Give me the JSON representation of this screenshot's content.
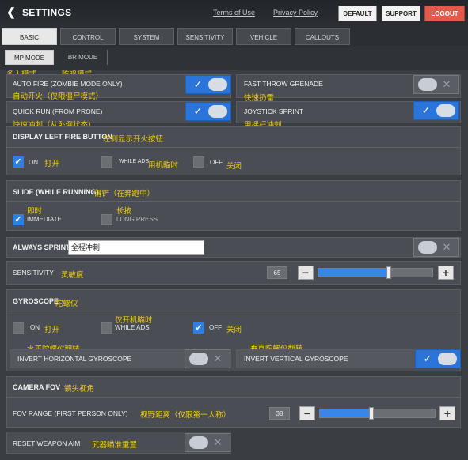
{
  "header": {
    "title": "SETTINGS",
    "links": [
      "Terms of Use",
      "Privacy Policy"
    ],
    "buttons": {
      "default": "DEFAULT",
      "support": "SUPPORT",
      "logout": "LOGOUT"
    }
  },
  "tabs": [
    "BASIC",
    "CONTROL",
    "SYSTEM",
    "SENSITIVITY",
    "VEHICLE",
    "CALLOUTS"
  ],
  "active_tab": "BASIC",
  "subtabs": [
    "MP MODE",
    "BR MODE"
  ],
  "active_subtab": "MP MODE",
  "annotations": {
    "mp_mode": "多人模式",
    "br_mode": "吃鸡模式"
  },
  "settings": {
    "auto_fire": {
      "label": "AUTO FIRE (ZOMBIE MODE ONLY)",
      "cn": "自动开火（仅限僵尸模式）",
      "on": true
    },
    "fast_throw": {
      "label": "FAST THROW GRENADE",
      "cn": "快速扔雷",
      "on": false
    },
    "quick_run": {
      "label": "QUICK RUN (FROM PRONE)",
      "cn": "快速冲刺（从卧倒状态）",
      "on": true
    },
    "joystick_sprint": {
      "label": "JOYSTICK SPRINT",
      "cn": "用摇杆冲刺",
      "on": true
    },
    "left_fire": {
      "label": "DISPLAY LEFT FIRE BUTTON",
      "cn": "左侧显示开火按钮",
      "options": [
        {
          "label": "ON",
          "cn": "打开",
          "checked": true
        },
        {
          "label": "WHILE ADS",
          "cn": "用机瞄时",
          "checked": false
        },
        {
          "label": "OFF",
          "cn": "关闭",
          "checked": false
        }
      ]
    },
    "slide": {
      "label": "SLIDE (WHILE RUNNING)",
      "cn": "滑铲（在奔跑中）",
      "options": [
        {
          "label": "IMMEDIATE",
          "cn": "即时",
          "checked": true
        },
        {
          "label": "LONG PRESS",
          "cn": "长按",
          "checked": false
        }
      ]
    },
    "always_sprint": {
      "label": "ALWAYS SPRINT",
      "cn": "全程冲刺",
      "on": false
    },
    "sensitivity": {
      "label": "SENSITIVITY",
      "cn": "灵敏度",
      "value": "65",
      "fraction": 0.62
    },
    "gyroscope": {
      "label": "GYROSCOPE",
      "cn": "陀螺仪",
      "options": [
        {
          "label": "ON",
          "cn": "打开",
          "checked": false
        },
        {
          "label": "WHILE ADS",
          "cn": "仅开机瞄时",
          "checked": false
        },
        {
          "label": "OFF",
          "cn": "关闭",
          "checked": true
        }
      ]
    },
    "invert_h": {
      "label": "INVERT HORIZONTAL GYROSCOPE",
      "cn": "水平陀螺仪翻转",
      "on": false
    },
    "invert_v": {
      "label": "INVERT VERTICAL GYROSCOPE",
      "cn": "垂直陀螺仪翻转",
      "on": true
    },
    "camera_fov": {
      "label": "CAMERA FOV",
      "cn": "镜头视角"
    },
    "fov_range": {
      "label": "FOV RANGE (FIRST PERSON ONLY)",
      "cn": "视野距离（仅限第一人称）",
      "value": "38",
      "fraction": 0.45
    },
    "reset_aim": {
      "label": "RESET WEAPON AIM",
      "cn": "武器瞄准重置",
      "on": false
    }
  },
  "colors": {
    "accent": "#2b74d9",
    "annotation": "#f0d000",
    "logout": "#e15a4c"
  }
}
